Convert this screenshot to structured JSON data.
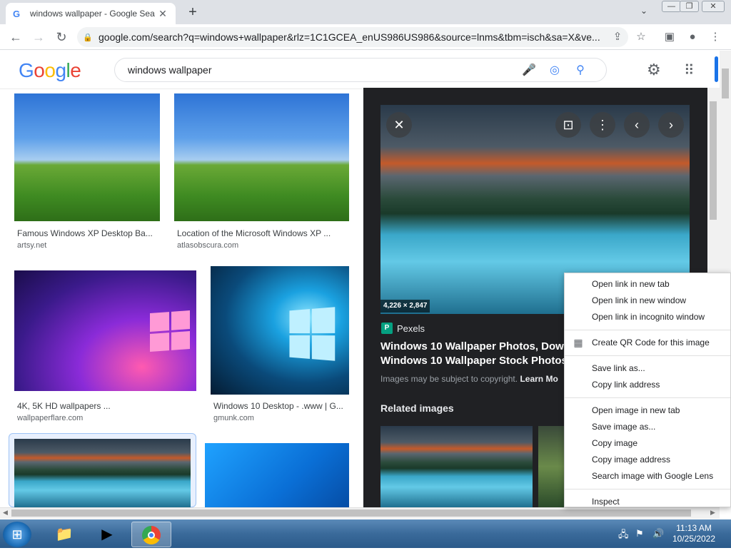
{
  "browser": {
    "tab_title": "windows wallpaper - Google Sea",
    "tab_favicon": "G",
    "url": "google.com/search?q=windows+wallpaper&rlz=1C1GCEA_enUS986US986&source=lnms&tbm=isch&sa=X&ve..."
  },
  "google": {
    "logo": "Google",
    "query": "windows wallpaper"
  },
  "results": [
    {
      "caption": "Famous Windows XP Desktop Ba...",
      "source": "artsy.net"
    },
    {
      "caption": "Location of the Microsoft Windows XP ...",
      "source": "atlasobscura.com"
    },
    {
      "caption": "4K, 5K HD wallpapers ...",
      "source": "wallpaperflare.com"
    },
    {
      "caption": "Windows 10 Desktop - .www | G...",
      "source": "gmunk.com"
    }
  ],
  "preview": {
    "dimensions": "4,226 × 2,847",
    "source_icon": "P",
    "source_name": "Pexels",
    "title_line1": "Windows 10 Wallpaper Photos, Downlo",
    "title_line2": "Windows 10 Wallpaper Stock Photos &",
    "copyright_text": "Images may be subject to copyright.",
    "copyright_link": "Learn Mo",
    "related_heading": "Related images"
  },
  "context_menu": {
    "items": [
      "Open link in new tab",
      "Open link in new window",
      "Open link in incognito window",
      "Create QR Code for this image",
      "Save link as...",
      "Copy link address",
      "Open image in new tab",
      "Save image as...",
      "Copy image",
      "Copy image address",
      "Search image with Google Lens",
      "Inspect"
    ]
  },
  "taskbar": {
    "time": "11:13 AM",
    "date": "10/25/2022"
  },
  "colors": {
    "google_blue": "#4285f4",
    "google_red": "#ea4335",
    "google_yellow": "#fbbc05",
    "google_green": "#34a853",
    "panel_bg": "#202124"
  }
}
